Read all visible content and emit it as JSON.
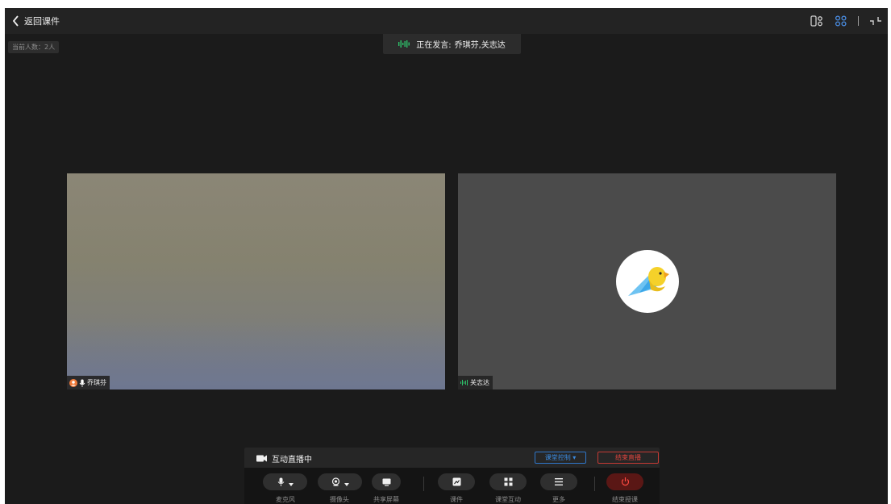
{
  "topbar": {
    "back_label": "返回课件",
    "tools": [
      {
        "name": "layout-speaker-icon",
        "color": "#d0d0d0"
      },
      {
        "name": "layout-grid-icon",
        "color": "#4a8fe7"
      },
      {
        "name": "exit-fullscreen-icon",
        "color": "#d0d0d0"
      }
    ]
  },
  "participants_count": "当前人数：2人",
  "speaking": {
    "label": "正在发言:",
    "names": "乔琪芬,关志达",
    "icon": "audio-level-icon",
    "icon_color": "#2ec26a"
  },
  "tiles": [
    {
      "name": "乔琪芬",
      "icons": [
        "user-avatar-icon",
        "microphone-icon"
      ]
    },
    {
      "name": "关志达",
      "icons": [
        "audio-level-icon"
      ],
      "avatar": "parrot-logo-icon"
    }
  ],
  "control_panel": {
    "status": "互动直播中",
    "class_control": "课堂控制",
    "end_live": "结束直播",
    "buttons": [
      {
        "label": "麦克风",
        "icon": "microphone-icon",
        "has_dropdown": true
      },
      {
        "label": "摄像头",
        "icon": "camera-icon",
        "has_dropdown": true
      },
      {
        "label": "共享屏幕",
        "icon": "share-screen-icon",
        "has_dropdown": false
      },
      {
        "label": "课件",
        "icon": "courseware-icon",
        "has_dropdown": false
      },
      {
        "label": "课堂互动",
        "icon": "interaction-grid-icon",
        "has_dropdown": false
      },
      {
        "label": "更多",
        "icon": "menu-icon",
        "has_dropdown": false
      },
      {
        "label": "结束授课",
        "icon": "power-icon",
        "has_dropdown": false
      }
    ]
  },
  "colors": {
    "accent_blue": "#2f76c9",
    "danger_red": "#d6352e",
    "speaking_green": "#2ec26a",
    "background": "#1b1b1b"
  }
}
